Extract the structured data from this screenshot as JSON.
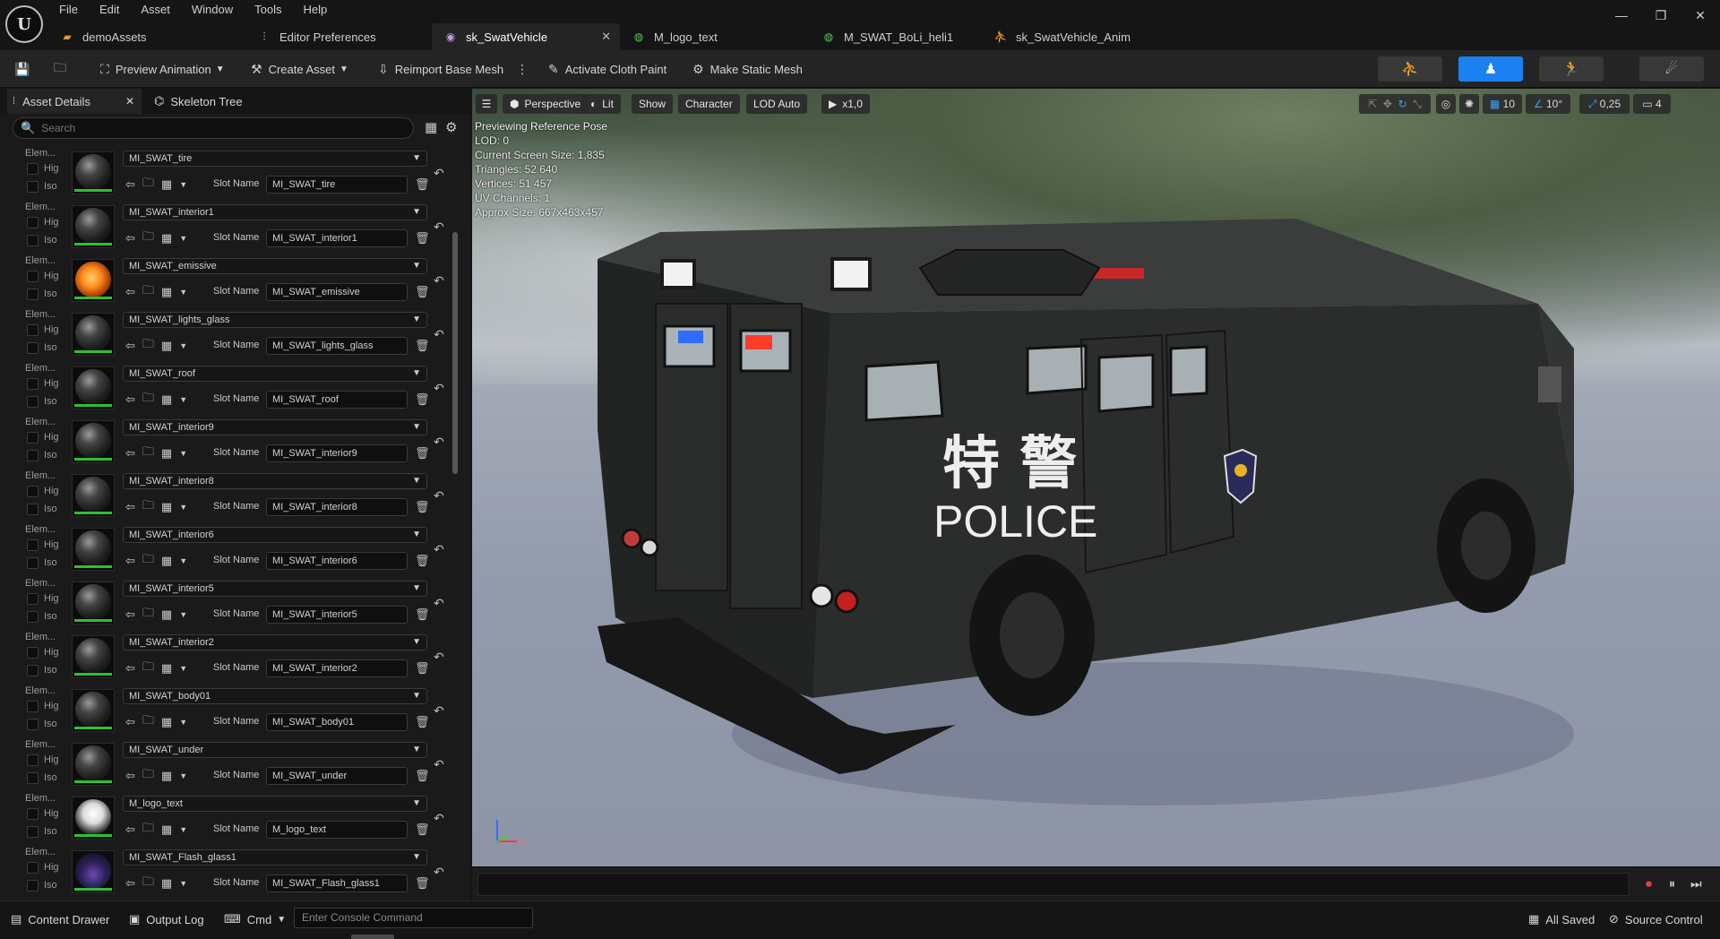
{
  "app": {
    "menu": [
      "File",
      "Edit",
      "Asset",
      "Window",
      "Tools",
      "Help"
    ],
    "tabs": [
      {
        "label": "demoAssets",
        "icon": "folder-icon",
        "color": "#e09a2c"
      },
      {
        "label": "Editor Preferences",
        "icon": "sliders-icon",
        "color": "#cfcfcf"
      },
      {
        "label": "sk_SwatVehicle",
        "icon": "skeletal-mesh-icon",
        "color": "#c59be0",
        "active": true
      },
      {
        "label": "M_logo_text",
        "icon": "material-icon",
        "color": "#59c159"
      },
      {
        "label": "M_SWAT_BoLi_heli1",
        "icon": "material-icon",
        "color": "#59c159"
      },
      {
        "label": "sk_SwatVehicle_Anim",
        "icon": "animation-icon",
        "color": "#cfcfcf"
      }
    ]
  },
  "toolbar": {
    "preview_animation": "Preview Animation",
    "create_asset": "Create Asset",
    "reimport": "Reimport Base Mesh",
    "cloth_paint": "Activate Cloth Paint",
    "static_mesh": "Make Static Mesh"
  },
  "left_panel": {
    "tab_details": "Asset Details",
    "tab_skeleton": "Skeleton Tree",
    "search_placeholder": "Search",
    "elem_label": "Elem...",
    "high_label": "Hig",
    "iso_label": "Iso",
    "slot_name_label": "Slot Name",
    "materials": [
      {
        "name": "MI_SWAT_tire",
        "slot": "MI_SWAT_tire",
        "ball": "dark"
      },
      {
        "name": "MI_SWAT_interior1",
        "slot": "MI_SWAT_interior1",
        "ball": "dark"
      },
      {
        "name": "MI_SWAT_emissive",
        "slot": "MI_SWAT_emissive",
        "ball": "emissive"
      },
      {
        "name": "MI_SWAT_lights_glass",
        "slot": "MI_SWAT_lights_glass",
        "ball": "dark"
      },
      {
        "name": "MI_SWAT_roof",
        "slot": "MI_SWAT_roof",
        "ball": "dark"
      },
      {
        "name": "MI_SWAT_interior9",
        "slot": "MI_SWAT_interior9",
        "ball": "dark"
      },
      {
        "name": "MI_SWAT_interior8",
        "slot": "MI_SWAT_interior8",
        "ball": "dark"
      },
      {
        "name": "MI_SWAT_interior6",
        "slot": "MI_SWAT_interior6",
        "ball": "dark"
      },
      {
        "name": "MI_SWAT_interior5",
        "slot": "MI_SWAT_interior5",
        "ball": "dark"
      },
      {
        "name": "MI_SWAT_interior2",
        "slot": "MI_SWAT_interior2",
        "ball": "dark"
      },
      {
        "name": "MI_SWAT_body01",
        "slot": "MI_SWAT_body01",
        "ball": "dark"
      },
      {
        "name": "MI_SWAT_under",
        "slot": "MI_SWAT_under",
        "ball": "dark"
      },
      {
        "name": "M_logo_text",
        "slot": "M_logo_text",
        "ball": "logo"
      },
      {
        "name": "MI_SWAT_Flash_glass1",
        "slot": "MI_SWAT_Flash_glass1",
        "ball": "flash"
      }
    ]
  },
  "viewport": {
    "perspective": "Perspective",
    "lit": "Lit",
    "show": "Show",
    "character": "Character",
    "lod": "LOD Auto",
    "speed": "x1,0",
    "grid_snap": "10",
    "rot_snap": "10°",
    "scale_snap": "0,25",
    "camera_speed": "4",
    "stats": {
      "header": "Previewing Reference Pose",
      "lod": "LOD: 0",
      "screen_size": "Current Screen Size: 1,835",
      "triangles": "Triangles: 52 640",
      "vertices": "Vertices: 51 457",
      "uv": "UV Channels: 1",
      "approx": "Approx Size: 667x463x457"
    },
    "decal_cn": "特 警",
    "decal_en": "POLICE",
    "axis_z": "Z",
    "axis_x": "X"
  },
  "statusbar": {
    "content_drawer": "Content Drawer",
    "output_log": "Output Log",
    "cmd": "Cmd",
    "console_placeholder": "Enter Console Command",
    "saved": "All Saved",
    "source_control": "Source Control"
  }
}
